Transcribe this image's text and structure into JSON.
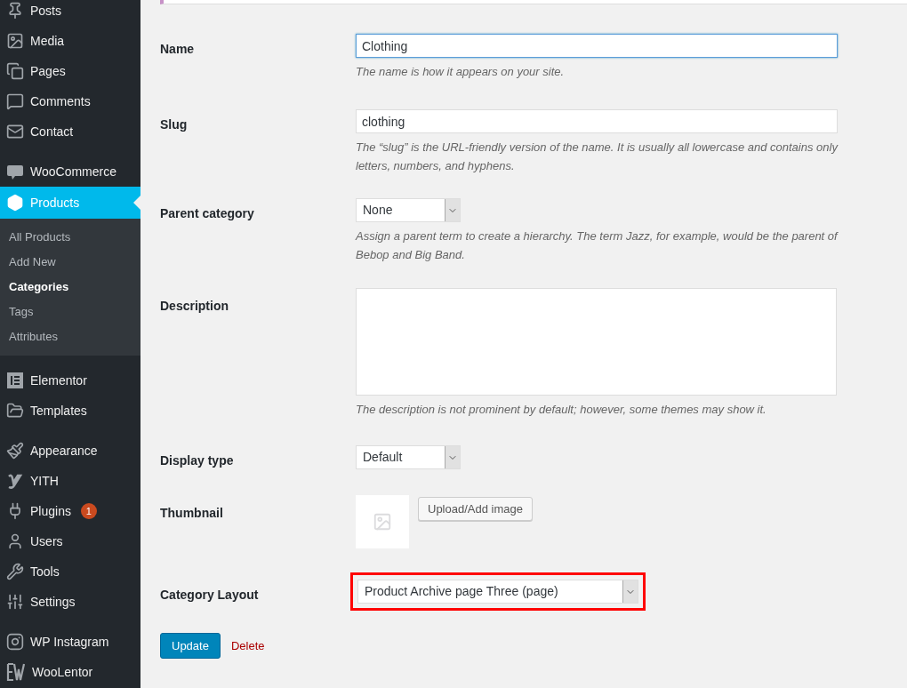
{
  "sidebar": {
    "groups": [
      {
        "items": [
          {
            "label": "Posts",
            "selected": false
          },
          {
            "label": "Media",
            "selected": false
          },
          {
            "label": "Pages",
            "selected": false
          },
          {
            "label": "Comments",
            "selected": false
          },
          {
            "label": "Contact",
            "selected": false
          }
        ]
      },
      {
        "items": [
          {
            "label": "WooCommerce",
            "selected": false
          },
          {
            "label": "Products",
            "selected": true,
            "children": [
              {
                "label": "All Products",
                "selected": false
              },
              {
                "label": "Add New",
                "selected": false
              },
              {
                "label": "Categories",
                "selected": true
              },
              {
                "label": "Tags",
                "selected": false
              },
              {
                "label": "Attributes",
                "selected": false
              }
            ]
          }
        ]
      },
      {
        "items": [
          {
            "label": "Elementor",
            "selected": false
          },
          {
            "label": "Templates",
            "selected": false
          }
        ]
      },
      {
        "items": [
          {
            "label": "Appearance",
            "selected": false
          },
          {
            "label": "YITH",
            "selected": false
          },
          {
            "label": "Plugins",
            "selected": false,
            "badge": "1"
          },
          {
            "label": "Users",
            "selected": false
          },
          {
            "label": "Tools",
            "selected": false
          },
          {
            "label": "Settings",
            "selected": false
          }
        ]
      },
      {
        "items": [
          {
            "label": "WP Instagram",
            "selected": false
          },
          {
            "label": "WooLentor",
            "selected": false
          }
        ]
      }
    ]
  },
  "form": {
    "fields": [
      {
        "kind": "text",
        "label": "Name",
        "value": "Clothing",
        "focused": true,
        "help": "The name is how it appears on your site."
      },
      {
        "kind": "text",
        "label": "Slug",
        "value": "clothing",
        "focused": false,
        "help": "The “slug” is the URL-friendly version of the name. It is usually all lowercase and contains only letters, numbers, and hyphens."
      },
      {
        "kind": "select",
        "label": "Parent category",
        "value": "None",
        "help": "Assign a parent term to create a hierarchy. The term Jazz, for example, would be the parent of Bebop and Big Band."
      },
      {
        "kind": "textarea",
        "label": "Description",
        "help": "The description is not prominent by default; however, some themes may show it."
      },
      {
        "kind": "select",
        "label": "Display type",
        "value": "Default"
      },
      {
        "kind": "image",
        "label": "Thumbnail",
        "button": "Upload/Add image"
      },
      {
        "kind": "select",
        "label": "Category Layout",
        "value": "Product Archive page Three (page)",
        "highlighted": true
      }
    ],
    "submit": "Update",
    "delete": "Delete"
  }
}
